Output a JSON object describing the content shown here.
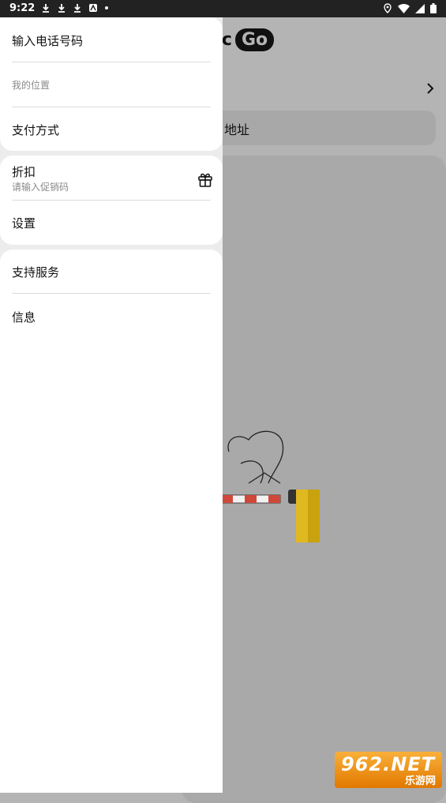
{
  "status_bar": {
    "time": "9:22",
    "left_icons": [
      "download-icon",
      "download-icon",
      "download-icon",
      "notification-icon",
      "dot-icon"
    ],
    "right_icons": [
      "location-icon",
      "wifi-icon",
      "signal-icon",
      "battery-icon"
    ]
  },
  "background": {
    "brand_text": "кс",
    "brand_badge": "Go",
    "address_text": "地址"
  },
  "drawer": {
    "phone_label": "输入电话号码",
    "location_label": "我的位置",
    "payment_label": "支付方式",
    "discount_label": "折扣",
    "discount_hint": "请输入促销码",
    "settings_label": "设置",
    "support_label": "支持服务",
    "info_label": "信息"
  },
  "watermark": {
    "top": "962.NET",
    "bottom": "乐游网"
  }
}
